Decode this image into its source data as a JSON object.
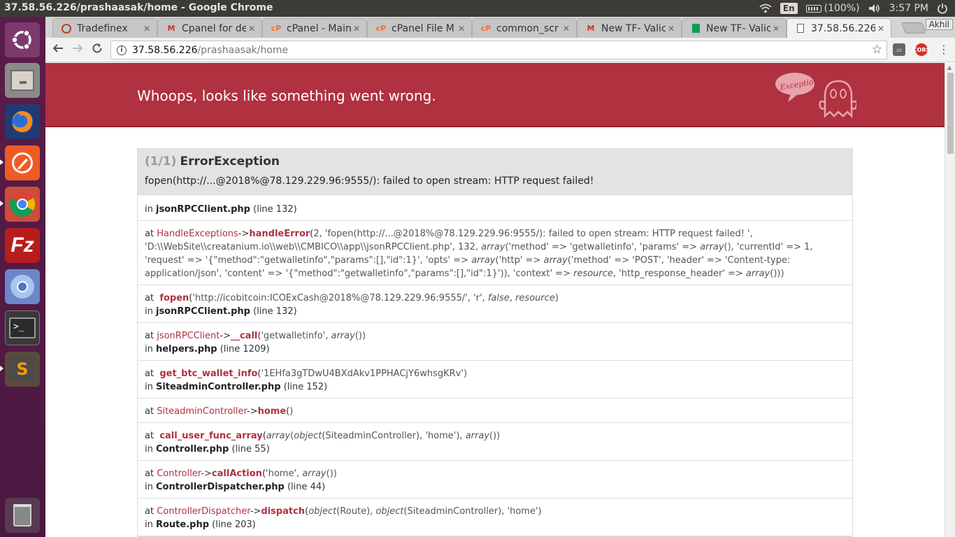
{
  "window": {
    "title": "37.58.56.226/prashaasak/home - Google Chrome"
  },
  "tray": {
    "lang": "En",
    "battery": "(100%)",
    "time": "3:57 PM"
  },
  "launcher": {
    "items": [
      "ubuntu-dash-icon",
      "files-icon",
      "firefox-icon",
      "postman-icon",
      "chrome-icon",
      "filezilla-icon",
      "chromium-icon",
      "terminal-icon",
      "sublime-text-icon",
      "trash-icon"
    ]
  },
  "tabs": [
    {
      "label": "Tradefinex",
      "icon": "tradefinex-icon"
    },
    {
      "label": "Cpanel for de",
      "icon": "gmail-icon"
    },
    {
      "label": "cPanel - Main",
      "icon": "cpanel-icon"
    },
    {
      "label": "cPanel File M",
      "icon": "cpanel-icon"
    },
    {
      "label": "common_scr",
      "icon": "cpanel-icon"
    },
    {
      "label": "New TF- Valic",
      "icon": "gmail-icon"
    },
    {
      "label": "New TF- Valic",
      "icon": "sheets-icon"
    },
    {
      "label": "37.58.56.226/",
      "icon": "page-icon"
    }
  ],
  "profile": "Akhil",
  "omnibox": {
    "host": "37.58.56.226",
    "path": "/prashaasak/home"
  },
  "page": {
    "header_message": "Whoops, looks like something went wrong.",
    "ghost_label": "Exception!",
    "exception": {
      "count": "(1/1)",
      "class": "ErrorException",
      "message": "fopen(http://...@2018%@78.129.229.96:9555/): failed to open stream: HTTP request failed!"
    },
    "frames": [
      {
        "in_file": "jsonRPCClient.php",
        "in_line": "(line 132)"
      },
      {
        "cls": "HandleExceptions",
        "arrow": "->",
        "fn": "handleError",
        "args": "2, 'fopen(http://...@2018%@78.129.229.96:9555/): failed to open stream: HTTP request failed! ', 'D:\\\\WebSite\\\\creatanium.io\\\\web\\\\CMBICO\\\\app\\\\jsonRPCClient.php', 132, array('method' => 'getwalletinfo', 'params' => array(), 'currentId' => 1, 'request' => '{\"method\":\"getwalletinfo\",\"params\":[],\"id\":1}', 'opts' => array('http' => array('method' => 'POST', 'header' => 'Content-type: application/json', 'content' => '{\"method\":\"getwalletinfo\",\"params\":[],\"id\":1}')), 'context' => resource, 'http_response_header' => array()))"
      },
      {
        "fn": "fopen",
        "args": "'http://icobitcoin:ICOExCash@2018%@78.129.229.96:9555/', 'r', false, resource)",
        "in_file": "jsonRPCClient.php",
        "in_line": "(line 132)"
      },
      {
        "cls": "jsonRPCClient",
        "arrow": "->",
        "fn": "__call",
        "args": "'getwalletinfo', array())",
        "in_file": "helpers.php",
        "in_line": "(line 1209)"
      },
      {
        "fn": "get_btc_wallet_info",
        "args": "'1EHfa3gTDwU4BXdAkv1PPHACjY6whsgKRv')",
        "in_file": "SiteadminController.php",
        "in_line": "(line 152)"
      },
      {
        "cls": "SiteadminController",
        "arrow": "->",
        "fn": "home",
        "args": ")"
      },
      {
        "fn": "call_user_func_array",
        "args": "array(object(SiteadminController), 'home'), array())",
        "in_file": "Controller.php",
        "in_line": "(line 55)"
      },
      {
        "cls": "Controller",
        "arrow": "->",
        "fn": "callAction",
        "args": "'home', array())",
        "in_file": "ControllerDispatcher.php",
        "in_line": "(line 44)"
      },
      {
        "cls": "ControllerDispatcher",
        "arrow": "->",
        "fn": "dispatch",
        "args": "object(Route), object(SiteadminController), 'home')",
        "in_file": "Route.php",
        "in_line": "(line 203)"
      }
    ]
  },
  "colors": {
    "header_red": "#b0313f",
    "launcher_purple": "#5a1d4a",
    "topbar": "#3c3b37"
  }
}
